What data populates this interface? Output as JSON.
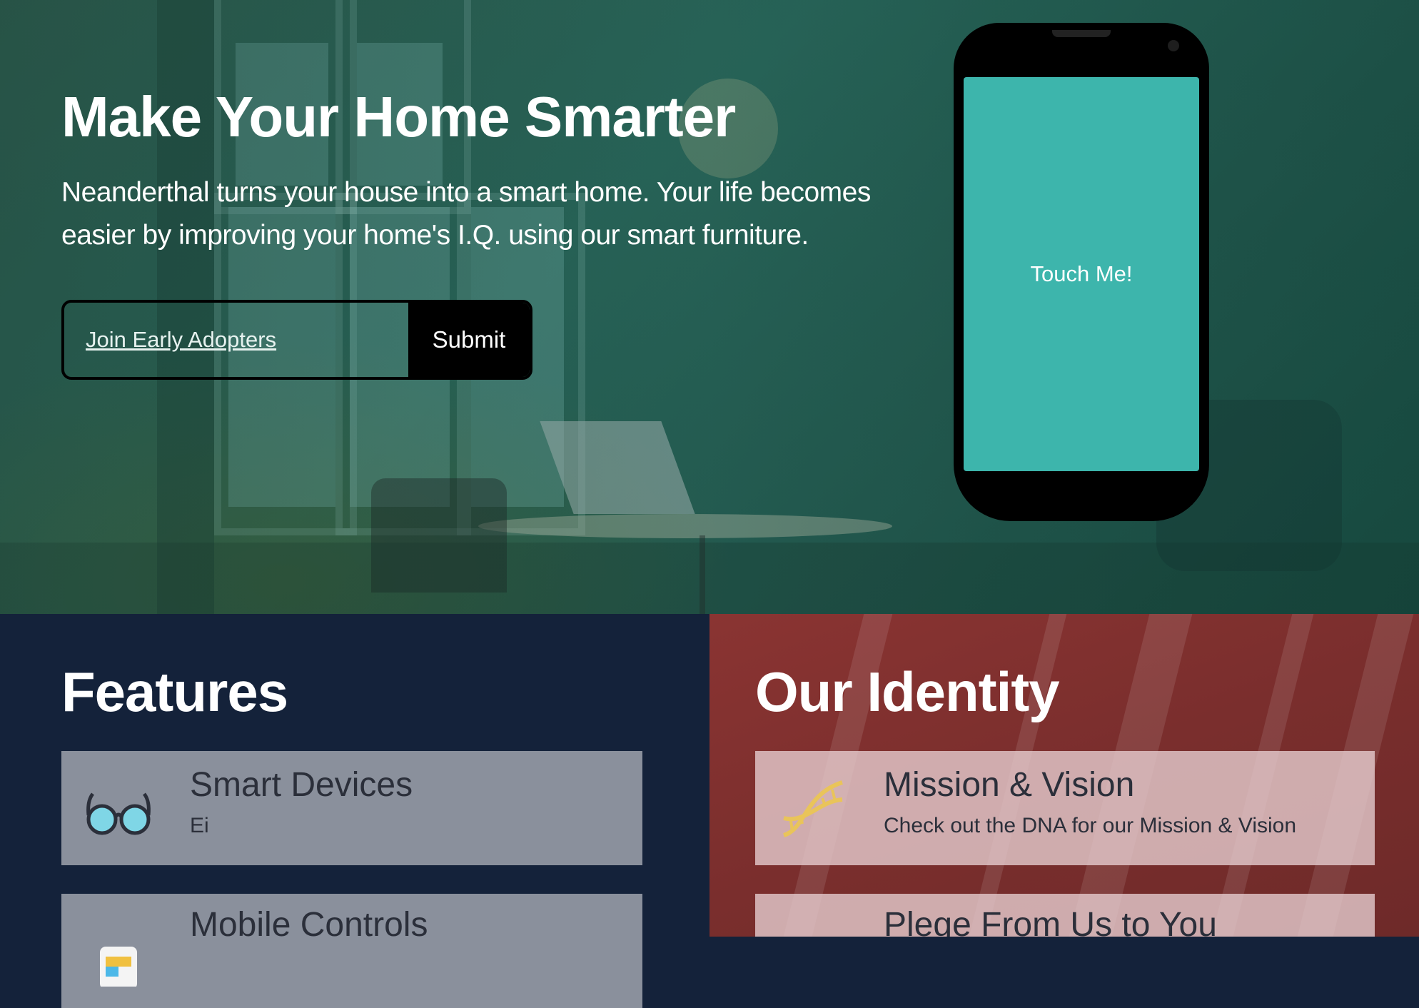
{
  "hero": {
    "title": "Make Your Home Smarter",
    "subtitle": "Neanderthal turns your house into a smart home. Your life becomes easier by improving your home's I.Q. using our smart furniture.",
    "signup_link": " Join Early Adopters",
    "submit_label": "Submit",
    "phone_button": "Touch Me!"
  },
  "features": {
    "title": "Features",
    "cards": [
      {
        "title": "Smart Devices",
        "desc": "Ei",
        "icon": "glasses-icon"
      },
      {
        "title": "Mobile Controls",
        "desc": "",
        "icon": "mobile-app-icon"
      }
    ]
  },
  "identity": {
    "title": "Our Identity",
    "cards": [
      {
        "title": "Mission & Vision",
        "desc": "Check out the DNA for our Mission & Vision",
        "icon": "dna-icon"
      },
      {
        "title": "Plege From Us to You",
        "desc": "",
        "icon": "gem-icon"
      }
    ]
  },
  "colors": {
    "features_bg": "#14223a",
    "identity_bg": "#7a2e2d",
    "phone_screen": "#3db5ac",
    "submit_bg": "#000000"
  }
}
